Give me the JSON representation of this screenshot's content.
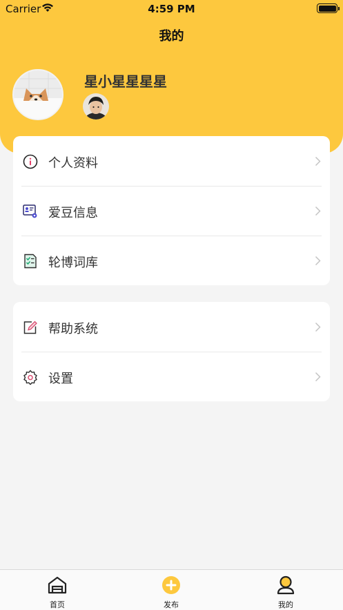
{
  "status_bar": {
    "carrier": "Carrier",
    "time": "4:59 PM"
  },
  "nav": {
    "title": "我的"
  },
  "profile": {
    "name": "星小星星星星"
  },
  "menu_group_1": [
    {
      "label": "个人资料",
      "icon": "info-icon"
    },
    {
      "label": "爱豆信息",
      "icon": "id-card-gear-icon"
    },
    {
      "label": "轮博词库",
      "icon": "checklist-icon"
    }
  ],
  "menu_group_2": [
    {
      "label": "帮助系统",
      "icon": "edit-icon"
    },
    {
      "label": "设置",
      "icon": "settings-icon"
    }
  ],
  "tabbar": [
    {
      "label": "首页",
      "icon": "home-icon"
    },
    {
      "label": "发布",
      "icon": "add-icon"
    },
    {
      "label": "我的",
      "icon": "profile-icon"
    }
  ],
  "colors": {
    "accent": "#fdc83e",
    "background": "#f4f4f4"
  }
}
